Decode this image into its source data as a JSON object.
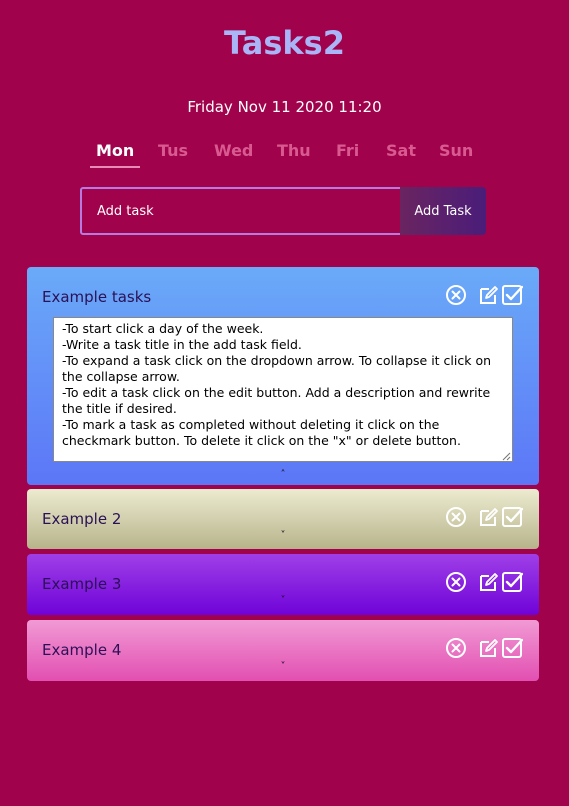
{
  "app": {
    "title": "Tasks2"
  },
  "datetime": "Friday Nov 11 2020 11:20",
  "days": [
    "Mon",
    "Tus",
    "Wed",
    "Thu",
    "Fri",
    "Sat",
    "Sun"
  ],
  "add": {
    "placeholder": "Add task",
    "button": "Add Task"
  },
  "tasks": [
    {
      "title": "Example tasks",
      "expanded": true,
      "description": "-To start click a day of the week.\n-Write a task title in the add task field.\n-To expand a task click on the dropdown arrow. To collapse it click on the collapse arrow.\n-To edit a task click on the edit button. Add a description and rewrite the title if desired.\n-To mark a task as completed without deleting it click on the checkmark button. To delete it click on the \"x\" or delete button.",
      "colors": [
        "#6aaaf8",
        "#5c76f7"
      ],
      "toggle": "˄"
    },
    {
      "title": "Example 2",
      "expanded": false,
      "colors": [
        "#ecebd0",
        "#b7b48b"
      ],
      "toggle": "˅"
    },
    {
      "title": "Example 3",
      "expanded": false,
      "colors": [
        "#9f3fe7",
        "#6f03d8"
      ],
      "toggle": "˅"
    },
    {
      "title": "Example 4",
      "expanded": false,
      "colors": [
        "#f19ad5",
        "#e24fb1"
      ],
      "toggle": "˅"
    }
  ],
  "icons": {
    "delete": "close-circle-icon",
    "edit": "edit-icon",
    "complete": "checkmark-icon"
  }
}
